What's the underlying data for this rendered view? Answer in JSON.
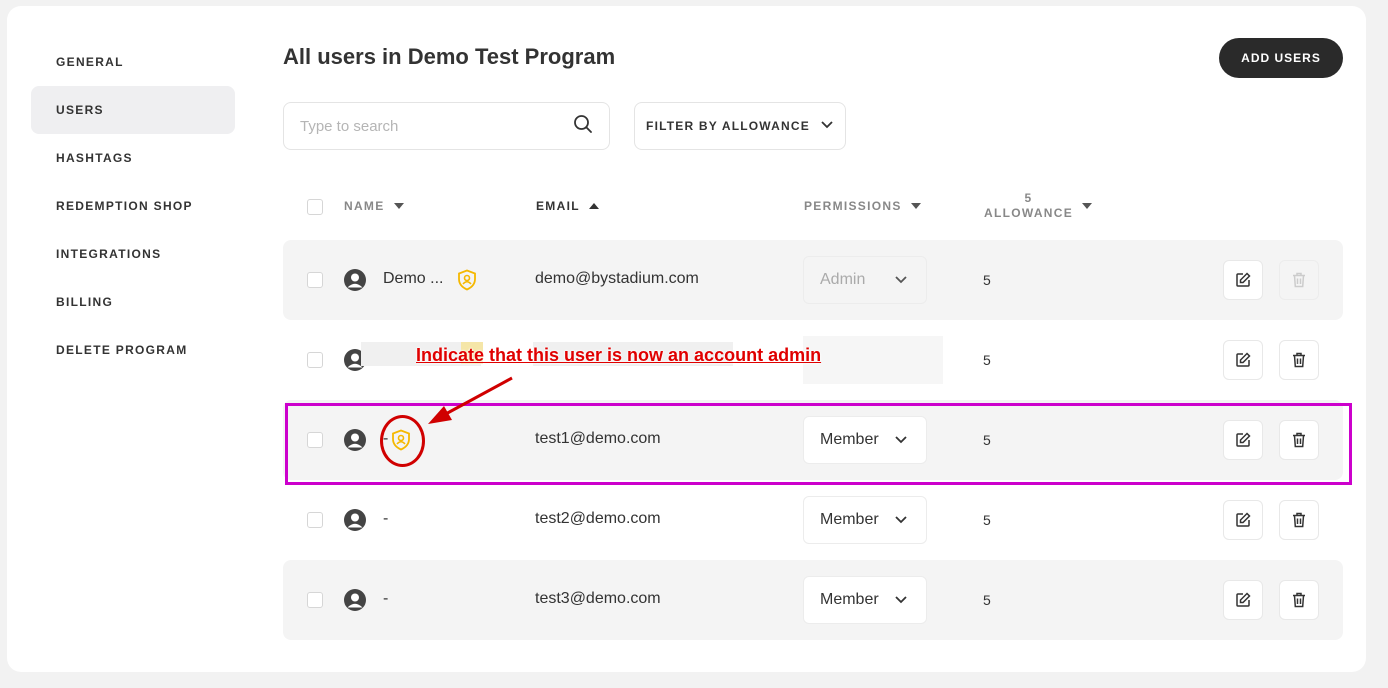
{
  "sidebar": {
    "items": [
      {
        "label": "GENERAL"
      },
      {
        "label": "USERS"
      },
      {
        "label": "HASHTAGS"
      },
      {
        "label": "REDEMPTION SHOP"
      },
      {
        "label": "INTEGRATIONS"
      },
      {
        "label": "BILLING"
      },
      {
        "label": "DELETE PROGRAM"
      }
    ],
    "active": "USERS"
  },
  "header": {
    "title": "All users in Demo Test Program",
    "add_users_label": "ADD USERS"
  },
  "toolbar": {
    "search_placeholder": "Type to search",
    "filter_label": "FILTER BY ALLOWANCE"
  },
  "table": {
    "columns": {
      "name": "NAME",
      "email": "EMAIL",
      "permissions": "PERMISSIONS",
      "allowance_count": "5",
      "allowance": "ALLOWANCE"
    },
    "rows": [
      {
        "name": "Demo ...",
        "email": "demo@bystadium.com",
        "permission": "Admin",
        "allowance": "5"
      },
      {
        "name": "",
        "email": "",
        "permission": "",
        "allowance": "5"
      },
      {
        "name": "-",
        "email": "test1@demo.com",
        "permission": "Member",
        "allowance": "5"
      },
      {
        "name": "-",
        "email": "test2@demo.com",
        "permission": "Member",
        "allowance": "5"
      },
      {
        "name": "-",
        "email": "test3@demo.com",
        "permission": "Member",
        "allowance": "5"
      }
    ]
  },
  "annotation": {
    "text": "Indicate that this user is now an account admin"
  },
  "colors": {
    "accent_dark": "#2a2a2a",
    "admin_shield": "#f5b800",
    "highlight": "#cc00cc",
    "annotation": "#e00000"
  }
}
